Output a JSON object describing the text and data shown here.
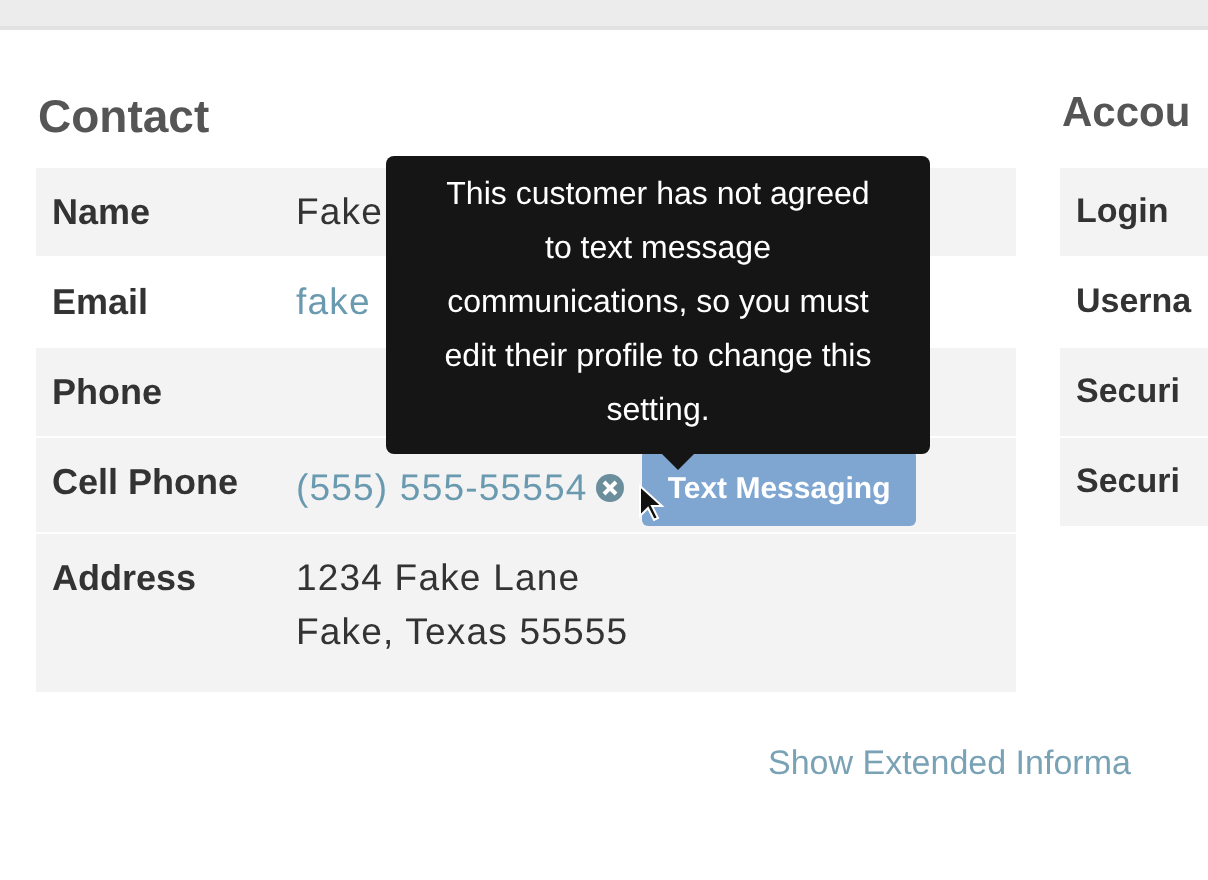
{
  "contact": {
    "title": "Contact",
    "rows": [
      {
        "label": "Name",
        "kind": "text",
        "value": "Fake"
      },
      {
        "label": "Email",
        "kind": "link",
        "value": "fake"
      },
      {
        "label": "Phone",
        "kind": "text",
        "value": ""
      },
      {
        "label": "Cell Phone",
        "kind": "phone",
        "value": "(555) 555-55554",
        "button": {
          "label": "Text Messaging",
          "disabled": true
        }
      },
      {
        "label": "Address",
        "kind": "address",
        "lines": [
          "1234 Fake Lane",
          "Fake, Texas 55555"
        ]
      }
    ],
    "tooltip": "This customer has not agreed to text message communications, so you must edit their profile to change this setting."
  },
  "account": {
    "title": "Accou",
    "rows": [
      "Login",
      "Userna",
      "Securi",
      "Securi"
    ]
  },
  "extended_link": "Show Extended Informa"
}
